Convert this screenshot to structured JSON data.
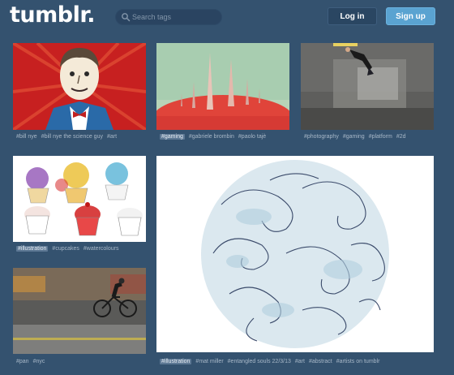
{
  "header": {
    "logo": "tumblr.",
    "search_placeholder": "Search tags",
    "login_label": "Log in",
    "signup_label": "Sign up"
  },
  "cards": [
    {
      "id": "billnye",
      "tags": [
        "#bill nye",
        "#bill nye the science guy",
        "#art"
      ],
      "highlight": -1
    },
    {
      "id": "spires",
      "tags": [
        "#gaming",
        "#gabriele brombin",
        "#paolo tajè"
      ],
      "highlight": 0
    },
    {
      "id": "wall",
      "tags": [
        "#photography",
        "#gaming",
        "#platform",
        "#2d"
      ],
      "highlight": -1
    },
    {
      "id": "cupcakes",
      "tags": [
        "#illustration",
        "#cupcakes",
        "#watercolours"
      ],
      "highlight": 0
    },
    {
      "id": "swirls",
      "tags": [
        "#illustration",
        "#mat miller",
        "#entangled souls 22/3/13",
        "#art",
        "#abstract",
        "#artists on tumblr"
      ],
      "highlight": 0
    },
    {
      "id": "cyclist",
      "tags": [
        "#pan",
        "#nyc"
      ],
      "highlight": -1
    }
  ],
  "colors": {
    "background": "#34526f",
    "signup": "#5aa3d1",
    "login": "#2a4662",
    "tag_text": "#a8b8c8",
    "tag_highlight": "#5d7894"
  }
}
